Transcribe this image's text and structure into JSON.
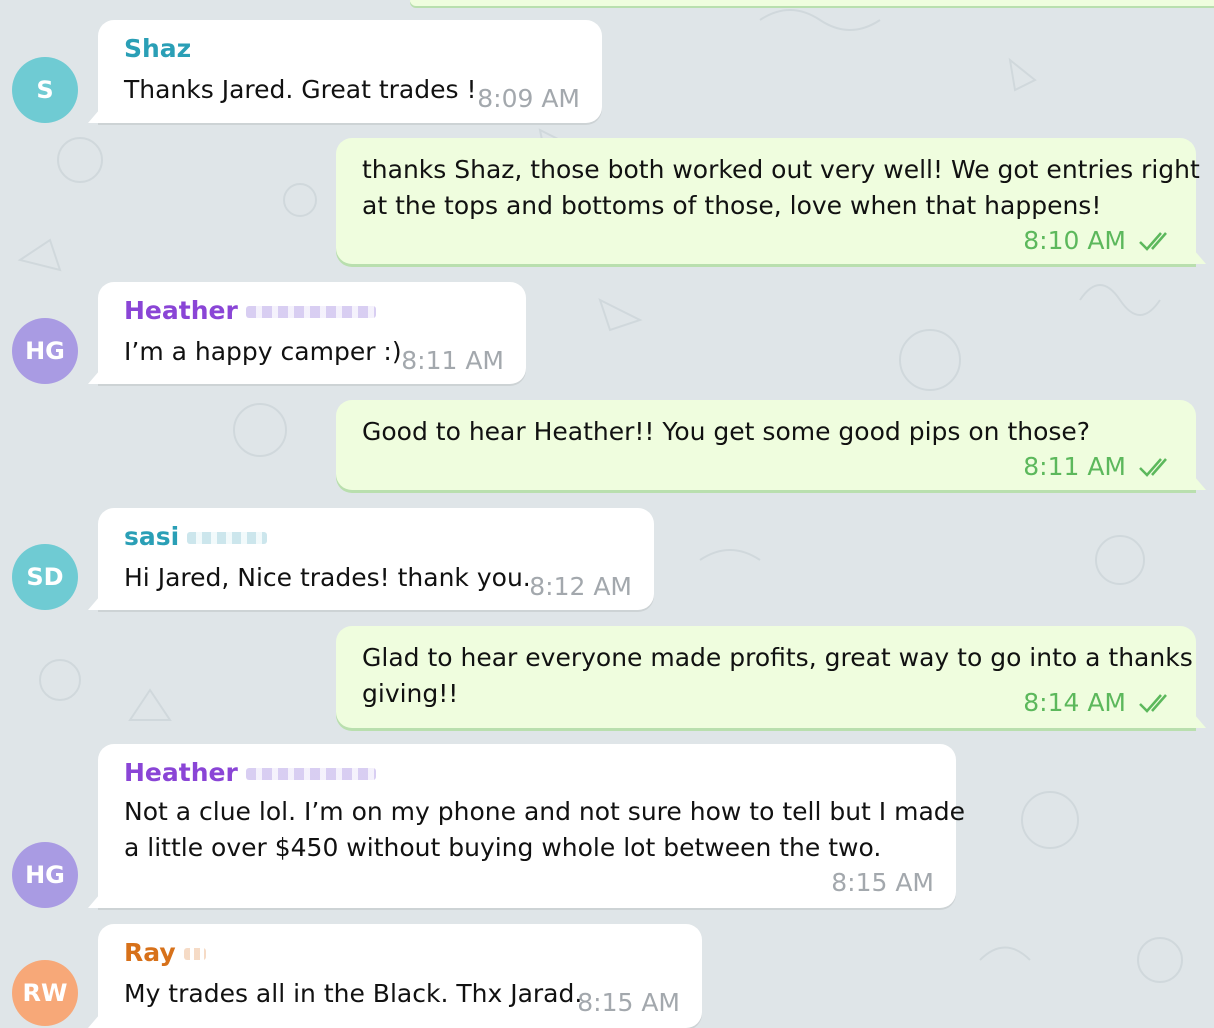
{
  "colors": {
    "avatar_s": "#6fcbd3",
    "avatar_hg": "#a99be3",
    "avatar_sd": "#6fcbd3",
    "avatar_rw": "#f7a878",
    "name_teal": "#2a9fb6",
    "name_purple": "#8a45d6",
    "name_orange": "#d7711a"
  },
  "messages": {
    "m1": {
      "avatar": "S",
      "sender": "Shaz",
      "text": "Thanks Jared. Great trades !",
      "time": "8:09 AM"
    },
    "m2": {
      "line1": "thanks Shaz, those both worked out very well! We got entries right",
      "line2": "at the tops and bottoms of those, love when that happens!",
      "time": "8:10 AM",
      "status_icon": "double-check-icon"
    },
    "m3": {
      "avatar": "HG",
      "sender": "Heather",
      "text": "I’m a happy camper :)",
      "time": "8:11 AM"
    },
    "m4": {
      "text": "Good to hear Heather!! You get some good pips on those?",
      "time": "8:11 AM",
      "status_icon": "double-check-icon"
    },
    "m5": {
      "avatar": "SD",
      "sender": "sasi",
      "text": "Hi Jared, Nice trades! thank you.",
      "time": "8:12 AM"
    },
    "m6": {
      "line1": "Glad to hear everyone made profits, great way to go into a thanks",
      "line2": "giving!!",
      "time": "8:14 AM",
      "status_icon": "double-check-icon"
    },
    "m7": {
      "avatar": "HG",
      "sender": "Heather",
      "line1": "Not a clue lol. I’m on my phone and not sure how to tell but I made",
      "line2": "a little over $450 without buying whole lot between the two.",
      "time": "8:15 AM"
    },
    "m8": {
      "avatar": "RW",
      "sender": "Ray",
      "text": "My trades all in the Black. Thx Jarad.",
      "time": "8:15 AM"
    }
  }
}
